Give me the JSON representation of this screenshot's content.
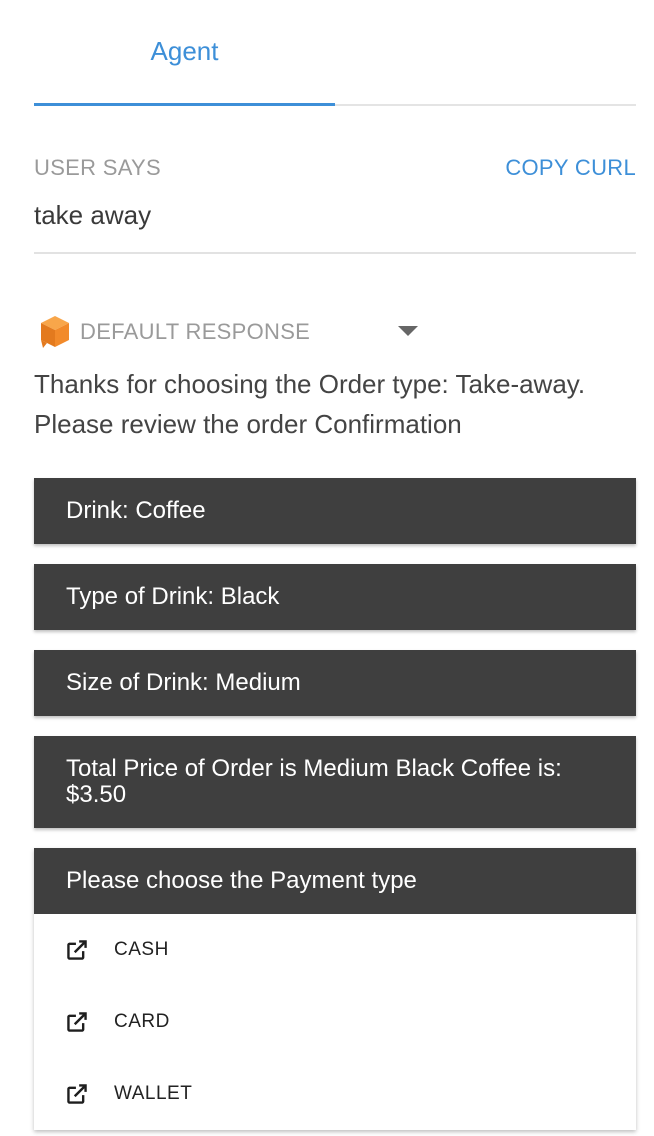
{
  "tabs": {
    "active": "Agent"
  },
  "user_says": {
    "label": "USER SAYS",
    "copy_curl": "COPY CURL",
    "value": "take away"
  },
  "response": {
    "header": "DEFAULT RESPONSE",
    "text": "Thanks for choosing the Order type: Take-away. Please review the order Confirmation",
    "icon": "orange-cube-icon"
  },
  "cards": [
    "Drink: Coffee",
    "Type of Drink: Black",
    "Size of Drink: Medium",
    "Total Price of Order is Medium Black Coffee is: $3.50"
  ],
  "payment": {
    "title": "Please choose the Payment type",
    "options": [
      "CASH",
      "CARD",
      "WALLET"
    ],
    "option_icon": "external-link-icon"
  },
  "colors": {
    "accent": "#3d8fd8",
    "card_bg": "#3f3f3f",
    "cube": "#f28a2a"
  }
}
